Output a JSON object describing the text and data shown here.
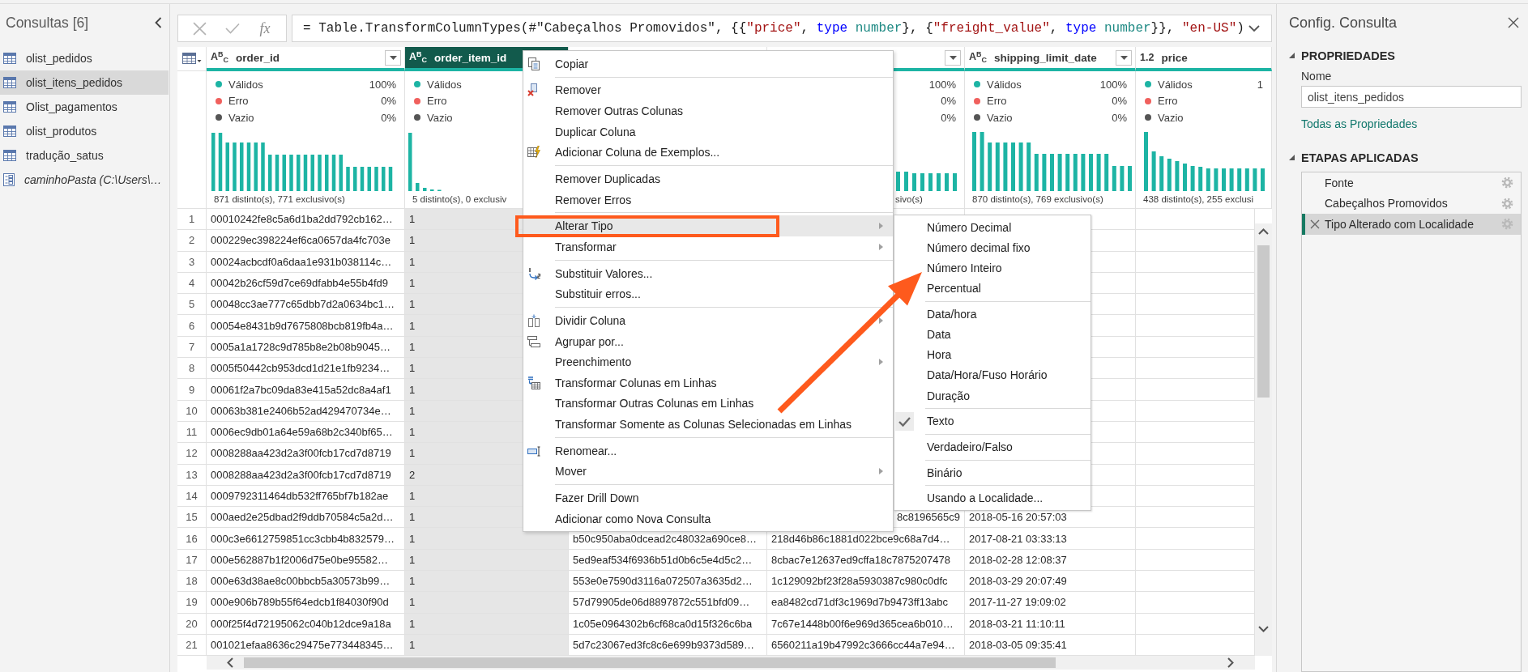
{
  "queries_pane": {
    "title": "Consultas [6]",
    "items": [
      {
        "name": "olist_pedidos",
        "kind": "table",
        "selected": false
      },
      {
        "name": "olist_itens_pedidos",
        "kind": "table",
        "selected": true
      },
      {
        "name": "Olist_pagamentos",
        "kind": "table",
        "selected": false
      },
      {
        "name": "olist_produtos",
        "kind": "table",
        "selected": false
      },
      {
        "name": "tradução_satus",
        "kind": "table",
        "selected": false
      },
      {
        "name": "caminhoPasta (C:\\Users\\…",
        "kind": "parameter",
        "selected": false
      }
    ]
  },
  "formula_bar": {
    "function_label": "fx",
    "tokens": [
      {
        "text": "= Table.TransformColumnTypes(#\"Cabeçalhos Promovidos\", {{",
        "kind": "plain"
      },
      {
        "text": "\"price\"",
        "kind": "string"
      },
      {
        "text": ", ",
        "kind": "plain"
      },
      {
        "text": "type ",
        "kind": "keyword"
      },
      {
        "text": "number",
        "kind": "type"
      },
      {
        "text": "}, {",
        "kind": "plain"
      },
      {
        "text": "\"freight_value\"",
        "kind": "string"
      },
      {
        "text": ", ",
        "kind": "plain"
      },
      {
        "text": "type ",
        "kind": "keyword"
      },
      {
        "text": "number",
        "kind": "type"
      },
      {
        "text": "}}, ",
        "kind": "plain"
      },
      {
        "text": "\"en-US\"",
        "kind": "string"
      },
      {
        "text": ")",
        "kind": "plain"
      }
    ]
  },
  "columns": [
    {
      "type_label": "A$^{B}$$_{C}$",
      "name": "order_id",
      "selected": false,
      "filter": true,
      "profile": {
        "stats": [
          {
            "label": "Válidos",
            "value": "100%",
            "color": "#1db4a4"
          },
          {
            "label": "Erro",
            "value": "0%",
            "color": "#f0605d"
          },
          {
            "label": "Vazio",
            "value": "0%",
            "color": "#555555"
          }
        ],
        "summary": "871 distinto(s), 771 exclusivo(s)"
      }
    },
    {
      "type_label": "A$^{B}$$_{C}$",
      "name": "order_item_id",
      "selected": true,
      "profile": {
        "stats": [
          {
            "label": "Válidos",
            "color": "#1db4a4"
          },
          {
            "label": "Erro",
            "color": "#f0605d"
          },
          {
            "label": "Vazio",
            "color": "#555555"
          }
        ],
        "summary": "5 distinto(s), 0 exclusiv"
      }
    },
    {},
    {
      "selected": false,
      "filter": true,
      "profile": {
        "stats": [
          {
            "value": "100%"
          },
          {
            "value": "0%"
          },
          {
            "value": "0%"
          }
        ],
        "summary": "sivo(s)"
      }
    },
    {
      "type_label": "A$^{B}$$_{C}$",
      "name": "shipping_limit_date",
      "selected": false,
      "filter": true,
      "profile": {
        "stats": [
          {
            "label": "Válidos",
            "value": "100%",
            "color": "#1db4a4"
          },
          {
            "label": "Erro",
            "value": "0%",
            "color": "#f0605d"
          },
          {
            "label": "Vazio",
            "value": "0%",
            "color": "#555555"
          }
        ],
        "summary": "870 distinto(s), 769 exclusivo(s)"
      }
    },
    {
      "type_label": "1.2",
      "name": "price",
      "selected": false,
      "profile": {
        "stats": [
          {
            "label": "Válidos",
            "value": "1",
            "color": "#1db4a4"
          },
          {
            "label": "Erro",
            "color": "#f0605d"
          },
          {
            "label": "Vazio",
            "color": "#555555"
          }
        ],
        "summary": "438 distinto(s), 255 exclusi"
      }
    }
  ],
  "rows": [
    {
      "number": "1",
      "cells": [
        "00010242fe8c5a6d1ba2dd792cb162…",
        "1"
      ]
    },
    {
      "number": "2",
      "cells": [
        "000229ec398224ef6ca0657da4fc703e",
        "1"
      ]
    },
    {
      "number": "3",
      "cells": [
        "00024acbcdf0a6daa1e931b038114c…",
        "1"
      ]
    },
    {
      "number": "4",
      "cells": [
        "00042b26cf59d7ce69dfabb4e55b4fd9",
        "1"
      ]
    },
    {
      "number": "5",
      "cells": [
        "00048cc3ae777c65dbb7d2a0634bc1…",
        "1"
      ]
    },
    {
      "number": "6",
      "cells": [
        "00054e8431b9d7675808bcb819fb4a…",
        "1"
      ]
    },
    {
      "number": "7",
      "cells": [
        "0005a1a1728c9d785b8e2b08b9045…",
        "1"
      ]
    },
    {
      "number": "8",
      "cells": [
        "0005f50442cb953dcd1d21e1fb9234…",
        "1"
      ]
    },
    {
      "number": "9",
      "cells": [
        "00061f2a7bc09da83e415a52dc8a4af1",
        "1"
      ]
    },
    {
      "number": "10",
      "cells": [
        "00063b381e2406b52ad429470734e…",
        "1"
      ]
    },
    {
      "number": "11",
      "cells": [
        "0006ec9db01a64e59a68b2c340bf65…",
        "1"
      ]
    },
    {
      "number": "12",
      "cells": [
        "0008288aa423d2a3f00fcb17cd7d8719",
        "1"
      ]
    },
    {
      "number": "13",
      "cells": [
        "0008288aa423d2a3f00fcb17cd7d8719",
        "2"
      ]
    },
    {
      "number": "14",
      "cells": [
        "0009792311464db532ff765bf7b182ae",
        "1"
      ]
    },
    {
      "number": "15",
      "cells": [
        "000aed2e25dbad2f9ddb70584c5a2d…",
        "1",
        null,
        "8c8196565c9",
        "2018-05-16 20:57:03"
      ]
    },
    {
      "number": "16",
      "cells": [
        "000c3e6612759851cc3cbb4b832579…",
        "1",
        "b50c950aba0dcead2c48032a690ce8…",
        "218d46b86c1881d022bce9c68a7d4…",
        "2017-08-21 03:33:13"
      ]
    },
    {
      "number": "17",
      "cells": [
        "000e562887b1f2006d75e0be95582…",
        "1",
        "5ed9eaf534f6936b51d0b6c5e4d5c2…",
        "8cbac7e12637ed9cffa18c7875207478",
        "2018-02-28 12:08:37"
      ]
    },
    {
      "number": "18",
      "cells": [
        "000e63d38ae8c00bbcb5a30573b99…",
        "1",
        "553e0e7590d3116a072507a3635d2…",
        "1c129092bf23f28a5930387c980c0dfc",
        "2018-03-29 20:07:49"
      ]
    },
    {
      "number": "19",
      "cells": [
        "000e906b789b55f64edcb1f84030f90d",
        "1",
        "57d79905de06d8897872c551bfd09…",
        "ea8482cd71df3c1969d7b9473ff13abc",
        "2017-11-27 19:09:02"
      ]
    },
    {
      "number": "20",
      "cells": [
        "000f25f4d72195062c040b12dce9a18a",
        "1",
        "1c05e0964302b6cf68ca0d15f326c6ba",
        "7c67e1448b00f6e969d365cea6b010…",
        "2018-03-21 11:10:11"
      ]
    },
    {
      "number": "21",
      "cells": [
        "001021efaa8636c29475e773448345…",
        "1",
        "5d7c23067ed3fc8c6e699b9373d589…",
        "6560211a19b47992c3666cc44a7e94…",
        "2018-03-05 09:35:41"
      ]
    }
  ],
  "context_menu": {
    "sections": [
      [
        {
          "label": "Copiar",
          "highlighted": false,
          "submenu": false
        }
      ],
      [
        {
          "label": "Remover",
          "highlighted": false,
          "submenu": false
        },
        {
          "label": "Remover Outras Colunas",
          "highlighted": false,
          "submenu": false
        },
        {
          "label": "Duplicar Coluna",
          "highlighted": false,
          "submenu": false
        },
        {
          "label": "Adicionar Coluna de Exemplos...",
          "highlighted": false,
          "submenu": false
        }
      ],
      [
        {
          "label": "Remover Duplicadas",
          "highlighted": false,
          "submenu": false
        },
        {
          "label": "Remover Erros",
          "highlighted": false,
          "submenu": false
        }
      ],
      [
        {
          "label": "Alterar Tipo",
          "highlighted": true,
          "submenu": true
        },
        {
          "label": "Transformar",
          "highlighted": false,
          "submenu": true
        }
      ],
      [
        {
          "label": "Substituir Valores...",
          "highlighted": false,
          "submenu": false
        },
        {
          "label": "Substituir erros...",
          "highlighted": false,
          "submenu": false
        }
      ],
      [
        {
          "label": "Dividir Coluna",
          "highlighted": false,
          "submenu": true
        },
        {
          "label": "Agrupar por...",
          "highlighted": false,
          "submenu": false
        },
        {
          "label": "Preenchimento",
          "highlighted": false,
          "submenu": true
        },
        {
          "label": "Transformar Colunas em Linhas",
          "highlighted": false,
          "submenu": false
        },
        {
          "label": "Transformar Outras Colunas em Linhas",
          "highlighted": false,
          "submenu": false
        },
        {
          "label": "Transformar Somente as Colunas Selecionadas em Linhas",
          "highlighted": false,
          "submenu": false
        }
      ],
      [
        {
          "label": "Renomear...",
          "highlighted": false,
          "submenu": false
        },
        {
          "label": "Mover",
          "highlighted": false,
          "submenu": true
        }
      ],
      [
        {
          "label": "Fazer Drill Down",
          "highlighted": false,
          "submenu": false
        },
        {
          "label": "Adicionar como Nova Consulta",
          "highlighted": false,
          "submenu": false
        }
      ]
    ]
  },
  "type_submenu": {
    "sections": [
      [
        {
          "label": "Número Decimal",
          "checked": false
        },
        {
          "label": "Número decimal fixo",
          "checked": false
        },
        {
          "label": "Número Inteiro",
          "checked": false
        },
        {
          "label": "Percentual",
          "checked": false
        }
      ],
      [
        {
          "label": "Data/hora",
          "checked": false
        },
        {
          "label": "Data",
          "checked": false
        },
        {
          "label": "Hora",
          "checked": false
        },
        {
          "label": "Data/Hora/Fuso Horário",
          "checked": false
        },
        {
          "label": "Duração",
          "checked": false
        }
      ],
      [
        {
          "label": "Texto",
          "checked": true
        }
      ],
      [
        {
          "label": "Verdadeiro/Falso",
          "checked": false
        }
      ],
      [
        {
          "label": "Binário",
          "checked": false
        }
      ],
      [
        {
          "label": "Usando a Localidade...",
          "checked": false
        }
      ]
    ]
  },
  "query_settings": {
    "title": "Config. Consulta",
    "properties": {
      "heading": "PROPRIEDADES",
      "expanded": true,
      "name_label": "Nome",
      "name_value": "olist_itens_pedidos",
      "all_properties_link": "Todas as Propriedades"
    },
    "applied_steps": {
      "heading": "ETAPAS APLICADAS",
      "expanded": true,
      "steps": [
        {
          "label": "Fonte",
          "selected": false
        },
        {
          "label": "Cabeçalhos Promovidos",
          "selected": false
        },
        {
          "label": "Tipo Alterado com Localidade",
          "selected": true
        }
      ]
    }
  }
}
